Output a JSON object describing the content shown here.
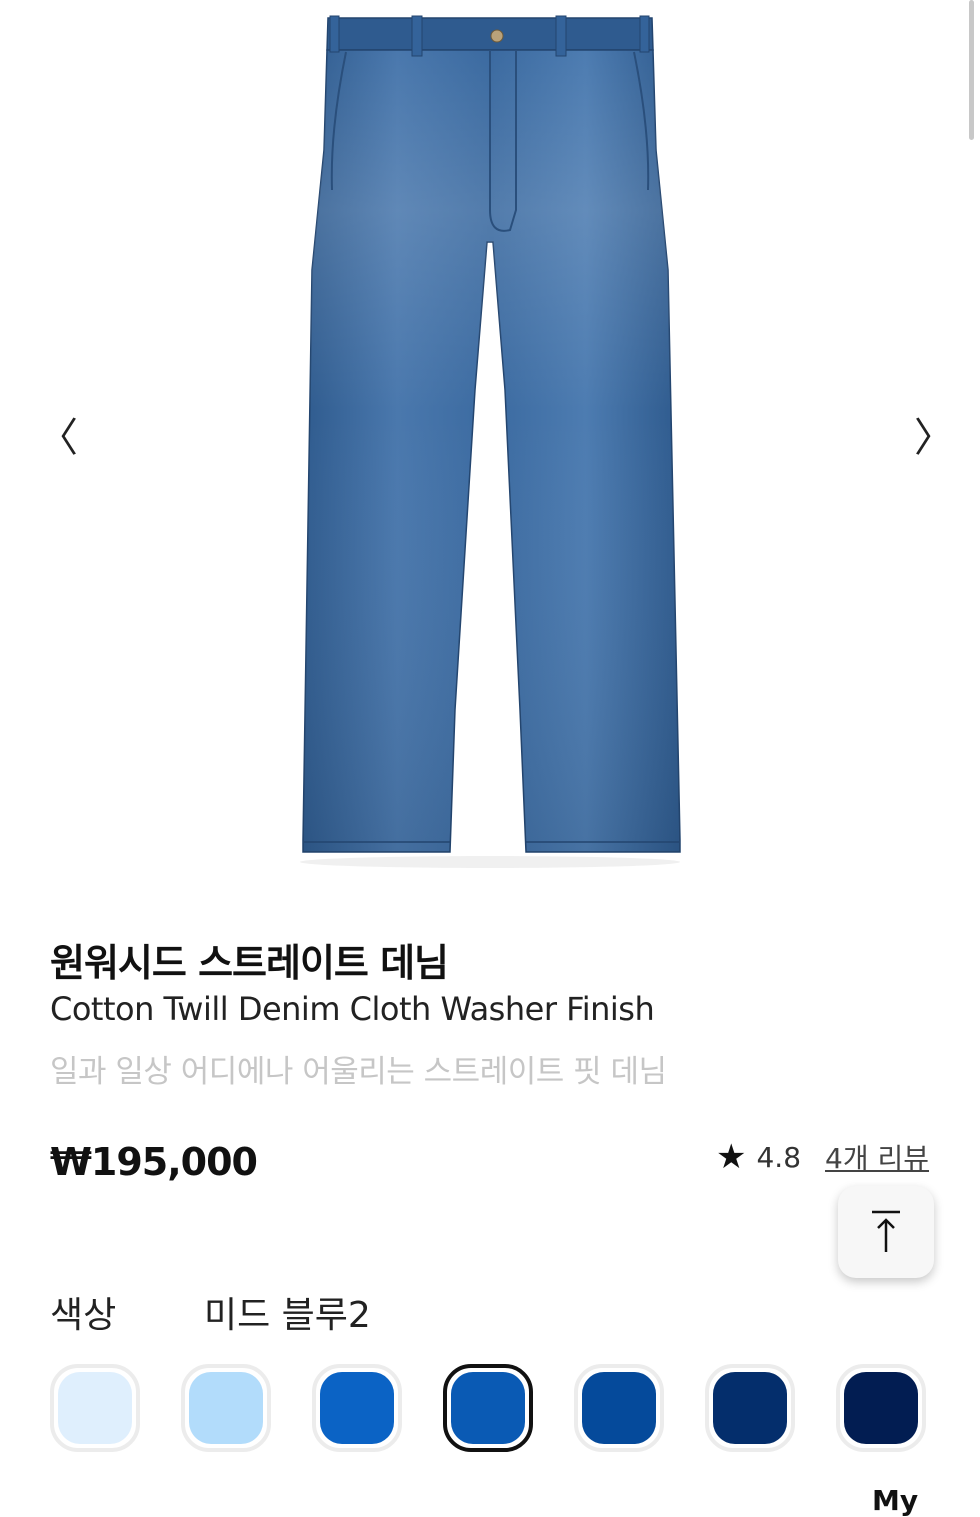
{
  "gallery": {
    "image_alt": "Denim straight jeans",
    "prev_icon": "chevron-left-icon",
    "prev_glyph": "〈",
    "next_icon": "chevron-right-icon",
    "next_glyph": "〉"
  },
  "product": {
    "name_ko": "원워시드 스트레이트 데님",
    "name_en": "Cotton Twill Denim Cloth Washer Finish",
    "description": "일과 일상 어디에나 어울리는 스트레이트 핏 데님",
    "price": "₩195,000",
    "rating": "4.8",
    "reviews_link": "4개 리뷰",
    "star_glyph": "★"
  },
  "color": {
    "label": "색상",
    "selected_name": "미드 블루2",
    "swatches": [
      {
        "color": "#dfeffd"
      },
      {
        "color": "#b2dcfb"
      },
      {
        "color": "#0b63c5"
      },
      {
        "color": "#0a5ab4",
        "selected": true
      },
      {
        "color": "#054a9b"
      },
      {
        "color": "#042e6c"
      },
      {
        "color": "#021d52"
      }
    ]
  },
  "scroll_top": {
    "icon": "arrow-up-icon"
  },
  "next_section_partial": "My"
}
